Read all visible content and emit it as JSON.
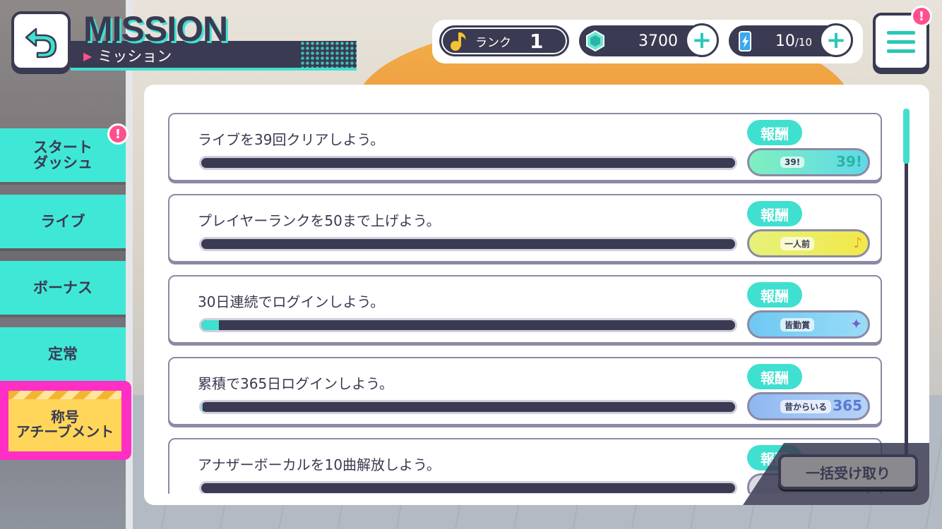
{
  "header": {
    "title_en": "MISSION",
    "title_jp": "ミッション"
  },
  "resources": {
    "rank_label": "ランク",
    "rank_value": "1",
    "gems": "3700",
    "energy_current": "10",
    "energy_max": "/10"
  },
  "alert_mark": "!",
  "tabs": [
    {
      "label": "スタート\nダッシュ",
      "alert": true
    },
    {
      "label": "ライブ",
      "alert": false
    },
    {
      "label": "ボーナス",
      "alert": false
    },
    {
      "label": "定常",
      "alert": false
    },
    {
      "label": "称号\nアチーブメント",
      "alert": false,
      "selected": true
    }
  ],
  "missions": [
    {
      "title": "ライブを39回クリアしよう。",
      "progress": 0.0,
      "reward_label": "報酬",
      "reward_text": "39!",
      "reward_deco": "39!"
    },
    {
      "title": "プレイヤーランクを50まで上げよう。",
      "progress": 0.0,
      "reward_label": "報酬",
      "reward_text": "一人前",
      "reward_deco": "♪"
    },
    {
      "title": "30日連続でログインしよう。",
      "progress": 0.033,
      "reward_label": "報酬",
      "reward_text": "皆勤賞",
      "reward_deco": "✦"
    },
    {
      "title": "累積で365日ログインしよう。",
      "progress": 0.003,
      "reward_label": "報酬",
      "reward_text": "昔からいる",
      "reward_deco": "365"
    },
    {
      "title": "アナザーボーカルを10曲解放しよう。",
      "progress": 0.0,
      "reward_label": "報酬",
      "reward_text": "",
      "reward_deco": ""
    }
  ],
  "collect_all_label": "一括受け取り",
  "colors": {
    "navy": "#3a3a52",
    "teal": "#3fe0cf",
    "pink": "#ff4f8d",
    "selected_border": "#ff2ec4",
    "selected_fill": "#ffd65a"
  }
}
